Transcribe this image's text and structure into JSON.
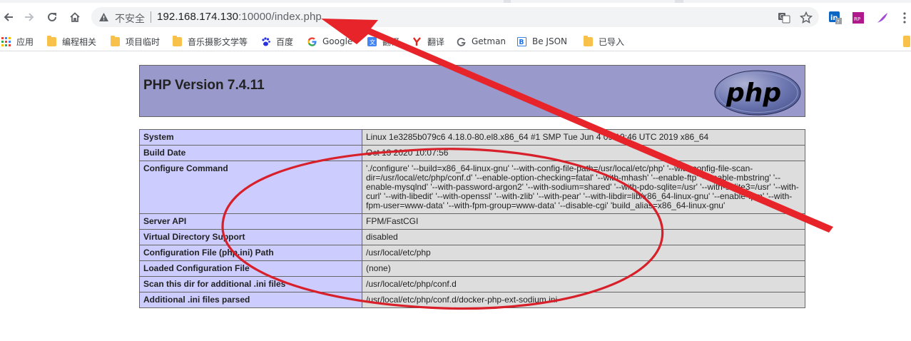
{
  "browser": {
    "url_security_label": "不安全",
    "url_host": "192.168.174.130",
    "url_rest": ":10000/index.php",
    "icons": [
      "back-icon",
      "forward-icon",
      "reload-icon",
      "home-icon",
      "warning-icon",
      "translate-icon",
      "star-icon"
    ],
    "extensions": [
      "linkedin-extension-icon",
      "rp-extension-icon",
      "feather-extension-icon",
      "menu-dots-icon"
    ]
  },
  "bookmarks": [
    {
      "label": "应用",
      "icon": "apps-grid-icon"
    },
    {
      "label": "编程相关",
      "icon": "folder-icon"
    },
    {
      "label": "项目临时",
      "icon": "folder-icon"
    },
    {
      "label": "音乐摄影文学等",
      "icon": "folder-icon"
    },
    {
      "label": "百度",
      "icon": "baidu-paw-icon"
    },
    {
      "label": "Google",
      "icon": "google-icon"
    },
    {
      "label": "翻译",
      "icon": "translate-icon"
    },
    {
      "label": "翻译",
      "icon": "youdao-icon"
    },
    {
      "label": "Getman",
      "icon": "g-icon"
    },
    {
      "label": "Be JSON",
      "icon": "bejson-icon"
    },
    {
      "label": "已导入",
      "icon": "folder-icon"
    }
  ],
  "php": {
    "title": "PHP Version 7.4.11",
    "logo_text": "php",
    "rows": [
      {
        "key": "System",
        "value": "Linux 1e3285b079c6 4.18.0-80.el8.x86_64 #1 SMP Tue Jun 4 09:19:46 UTC 2019 x86_64"
      },
      {
        "key": "Build Date",
        "value": "Oct 13 2020 10:07:56"
      },
      {
        "key": "Configure Command",
        "value": "'./configure' '--build=x86_64-linux-gnu' '--with-config-file-path=/usr/local/etc/php' '--with-config-file-scan-dir=/usr/local/etc/php/conf.d' '--enable-option-checking=fatal' '--with-mhash' '--enable-ftp' '--enable-mbstring' '--enable-mysqlnd' '--with-password-argon2' '--with-sodium=shared' '--with-pdo-sqlite=/usr' '--with-sqlite3=/usr' '--with-curl' '--with-libedit' '--with-openssl' '--with-zlib' '--with-pear' '--with-libdir=lib/x86_64-linux-gnu' '--enable-fpm' '--with-fpm-user=www-data' '--with-fpm-group=www-data' '--disable-cgi' 'build_alias=x86_64-linux-gnu'"
      },
      {
        "key": "Server API",
        "value": "FPM/FastCGI"
      },
      {
        "key": "Virtual Directory Support",
        "value": "disabled"
      },
      {
        "key": "Configuration File (php.ini) Path",
        "value": "/usr/local/etc/php"
      },
      {
        "key": "Loaded Configuration File",
        "value": "(none)"
      },
      {
        "key": "Scan this dir for additional .ini files",
        "value": "/usr/local/etc/php/conf.d"
      },
      {
        "key": "Additional .ini files parsed",
        "value": "/usr/local/etc/php/conf.d/docker-php-ext-sodium.ini"
      }
    ]
  },
  "annotation": {
    "arrow_color": "#e8242b",
    "ellipse_color": "#d8202a"
  }
}
